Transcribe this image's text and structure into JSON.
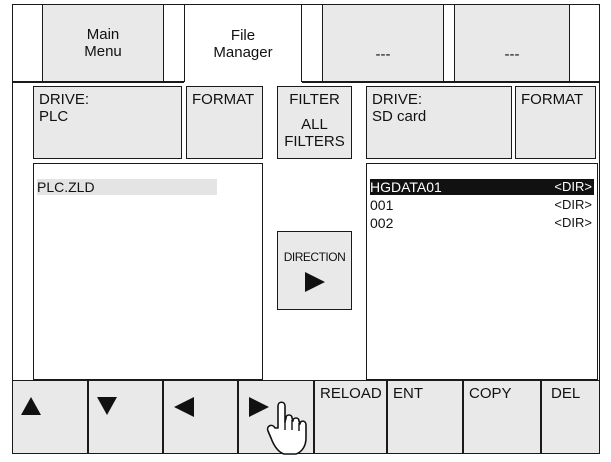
{
  "tabs": [
    {
      "line1": "Main",
      "line2": "Menu"
    },
    {
      "line1": "File",
      "line2": "Manager"
    },
    {
      "label": "---"
    },
    {
      "label": "---"
    }
  ],
  "left_drive": {
    "label": "DRIVE:",
    "value": "PLC",
    "format_label": "FORMAT"
  },
  "filter": {
    "label": "FILTER",
    "value_line1": "ALL",
    "value_line2": "FILTERS"
  },
  "right_drive": {
    "label": "DRIVE:",
    "value": "SD card",
    "format_label": "FORMAT"
  },
  "left_files": [
    {
      "name": "PLC.ZLD",
      "tag": ""
    }
  ],
  "right_files": [
    {
      "name": "HGDATA01",
      "tag": "<DIR>",
      "selected": true
    },
    {
      "name": "001",
      "tag": "<DIR>",
      "selected": false
    },
    {
      "name": "002",
      "tag": "<DIR>",
      "selected": false
    }
  ],
  "direction": {
    "label": "DIRECTION",
    "arrow_icon": "play-right-icon"
  },
  "bottom_buttons": {
    "up_icon": "arrow-up-icon",
    "down_icon": "arrow-down-icon",
    "left_icon": "arrow-left-icon",
    "right_icon": "arrow-right-icon",
    "reload": "RELOAD",
    "ent": "ENT",
    "copy": "COPY",
    "del": "DEL"
  },
  "pointer_icon": "hand-pointer-icon",
  "colors": {
    "button_bg": "#e9e9e9",
    "border": "#1a1a1a",
    "selection": "#111111",
    "highlight": "#e4e4e4"
  }
}
